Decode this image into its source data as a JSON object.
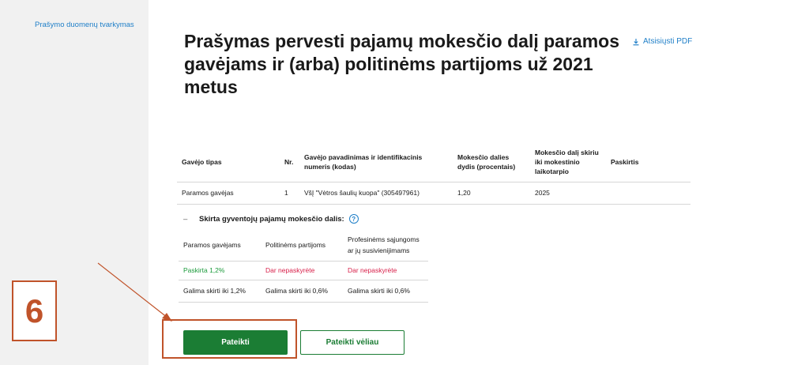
{
  "sidebar": {
    "link_label": "Prašymo duomenų tvarkymas"
  },
  "header": {
    "title": "Prašymas pervesti pajamų mokesčio dalį paramos gavėjams ir (arba) politinėms partijoms už 2021 metus",
    "download_label": "Atsisiųsti PDF"
  },
  "recipients_table": {
    "headers": [
      "Gavėjo tipas",
      "Nr.",
      "Gavėjo pavadinimas ir identifikacinis numeris (kodas)",
      "Mokesčio dalies dydis (procentais)",
      "Mokesčio dalį skiriu iki mokestinio laikotarpio",
      "Paskirtis"
    ],
    "rows": [
      [
        "Paramos gavėjas",
        "1",
        "VšĮ \"Vėtros šaulių kuopa\" (305497961)",
        "1,20",
        "2025",
        ""
      ]
    ]
  },
  "tax_share": {
    "collapse_symbol": "–",
    "title": "Skirta gyventojų pajamų mokesčio dalis:",
    "help_symbol": "?",
    "columns": [
      "Paramos gavėjams",
      "Politinėms partijoms",
      "Profesinėms sąjungoms ar jų susivienijimams"
    ],
    "status": [
      "Paskirta 1,2%",
      "Dar nepaskyrėte",
      "Dar nepaskyrėte"
    ],
    "limits": [
      "Galima skirti iki 1,2%",
      "Galima skirti iki 0,6%",
      "Galima skirti iki 0,6%"
    ]
  },
  "actions": {
    "submit_label": "Pateikti",
    "later_label": "Pateikti vėliau"
  },
  "annotation": {
    "step_number": "6",
    "color": "#c0532a"
  },
  "colors": {
    "primary_green": "#1b7d34",
    "link_blue": "#1f7fc8",
    "allocated_green": "#1a9a3a",
    "unallocated_red": "#d8204a"
  }
}
